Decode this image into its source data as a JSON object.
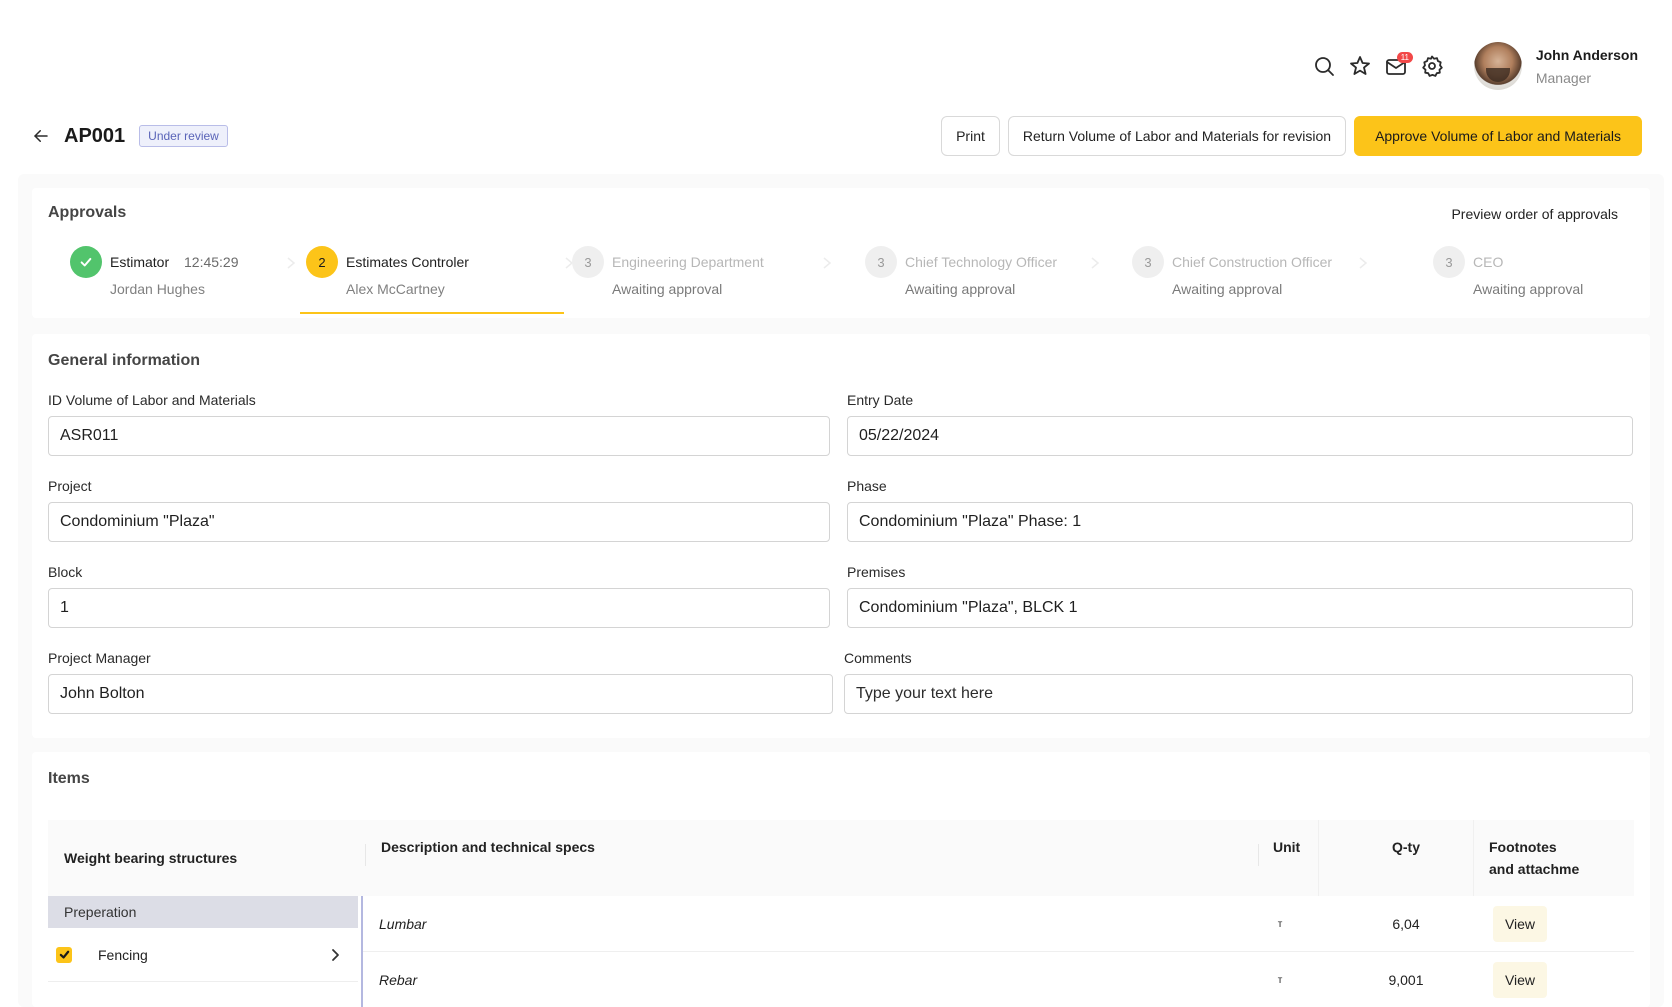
{
  "header": {
    "notifications_count": "11",
    "user": {
      "name": "John Anderson",
      "role": "Manager"
    }
  },
  "title_row": {
    "title": "AP001",
    "status": "Under review",
    "print_label": "Print",
    "return_label": "Return Volume of Labor and Materials for revision",
    "approve_label": "Approve Volume of Labor and Materials"
  },
  "approvals": {
    "title": "Approvals",
    "preview_label": "Preview order of approvals",
    "steps": [
      {
        "number": "",
        "name": "Estimator",
        "time": "12:45:29",
        "person": "Jordan Hughes",
        "state": "done"
      },
      {
        "number": "2",
        "name": "Estimates Controler",
        "time": "",
        "person": "Alex McCartney",
        "state": "active"
      },
      {
        "number": "3",
        "name": "Engineering Department",
        "time": "",
        "person": "Awaiting approval",
        "state": "pending"
      },
      {
        "number": "3",
        "name": "Chief Technology Officer",
        "time": "",
        "person": "Awaiting approval",
        "state": "pending"
      },
      {
        "number": "3",
        "name": "Chief Construction Officer",
        "time": "",
        "person": "Awaiting approval",
        "state": "pending"
      },
      {
        "number": "3",
        "name": "CEO",
        "time": "",
        "person": "Awaiting approval",
        "state": "pending"
      }
    ]
  },
  "general": {
    "title": "General information",
    "fields": {
      "id_label": "ID Volume of Labor and Materials",
      "id_value": "ASR011",
      "entry_date_label": "Entry Date",
      "entry_date_value": "05/22/2024",
      "project_label": "Project",
      "project_value": "Condominium \"Plaza\"",
      "phase_label": "Phase",
      "phase_value": "Condominium \"Plaza\" Phase: 1",
      "block_label": "Block",
      "block_value": "1",
      "premises_label": "Premises",
      "premises_value": "Condominium \"Plaza\", BLCK 1",
      "manager_label": "Project Manager",
      "manager_value": "John Bolton",
      "comments_label": "Comments",
      "comments_placeholder": "Type your text here"
    }
  },
  "items": {
    "title": "Items",
    "columns": {
      "structures": "Weight bearing structures",
      "description": "Description and technical specs",
      "unit": "Unit",
      "qty": "Q-ty",
      "footnotes_line1": "Footnotes",
      "footnotes_line2": "and attachme"
    },
    "group": "Preperation",
    "left_items": [
      {
        "label": "Fencing",
        "checked": true
      }
    ],
    "rows": [
      {
        "description": "Lumbar",
        "unit": "т",
        "qty": "6,04",
        "action": "View"
      },
      {
        "description": "Rebar",
        "unit": "т",
        "qty": "9,001",
        "action": "View"
      }
    ]
  },
  "colors": {
    "accent": "#fcc419",
    "success": "#52c46c",
    "status_badge": "#5a64b8",
    "notification": "#f24848"
  },
  "icons": [
    "search-icon",
    "star-icon",
    "mail-icon",
    "gear-icon",
    "arrow-left-icon",
    "check-icon",
    "chevron-right-icon"
  ]
}
